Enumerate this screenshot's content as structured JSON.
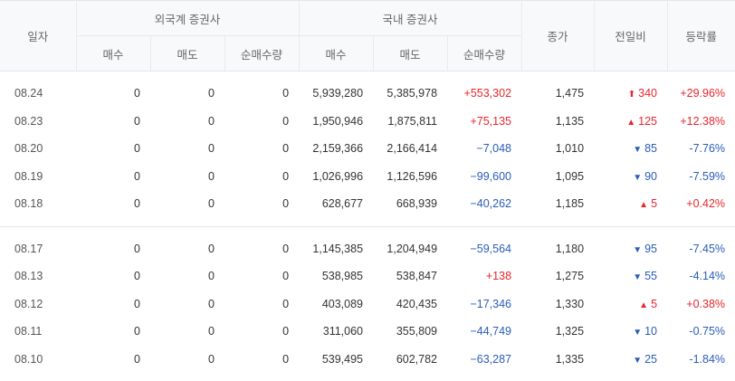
{
  "headers": {
    "date": "일자",
    "foreign": "외국계 증권사",
    "domestic": "국내 증권사",
    "close": "종가",
    "change": "전일비",
    "rate": "등락률",
    "buy": "매수",
    "sell": "매도",
    "net": "순매수량"
  },
  "groups": [
    [
      {
        "date": "08.24",
        "fb": "0",
        "fs": "0",
        "fn": "0",
        "db": "5,939,280",
        "ds": "5,385,978",
        "dn": "+553,302",
        "dn_dir": "up",
        "close": "1,475",
        "arrow": "⬆",
        "chg": "340",
        "chg_dir": "up",
        "rate": "+29.96%"
      },
      {
        "date": "08.23",
        "fb": "0",
        "fs": "0",
        "fn": "0",
        "db": "1,950,946",
        "ds": "1,875,811",
        "dn": "+75,135",
        "dn_dir": "up",
        "close": "1,135",
        "arrow": "▲",
        "chg": "125",
        "chg_dir": "up",
        "rate": "+12.38%"
      },
      {
        "date": "08.20",
        "fb": "0",
        "fs": "0",
        "fn": "0",
        "db": "2,159,366",
        "ds": "2,166,414",
        "dn": "−7,048",
        "dn_dir": "down",
        "close": "1,010",
        "arrow": "▼",
        "chg": "85",
        "chg_dir": "down",
        "rate": "-7.76%"
      },
      {
        "date": "08.19",
        "fb": "0",
        "fs": "0",
        "fn": "0",
        "db": "1,026,996",
        "ds": "1,126,596",
        "dn": "−99,600",
        "dn_dir": "down",
        "close": "1,095",
        "arrow": "▼",
        "chg": "90",
        "chg_dir": "down",
        "rate": "-7.59%"
      },
      {
        "date": "08.18",
        "fb": "0",
        "fs": "0",
        "fn": "0",
        "db": "628,677",
        "ds": "668,939",
        "dn": "−40,262",
        "dn_dir": "down",
        "close": "1,185",
        "arrow": "▲",
        "chg": "5",
        "chg_dir": "up",
        "rate": "+0.42%"
      }
    ],
    [
      {
        "date": "08.17",
        "fb": "0",
        "fs": "0",
        "fn": "0",
        "db": "1,145,385",
        "ds": "1,204,949",
        "dn": "−59,564",
        "dn_dir": "down",
        "close": "1,180",
        "arrow": "▼",
        "chg": "95",
        "chg_dir": "down",
        "rate": "-7.45%"
      },
      {
        "date": "08.13",
        "fb": "0",
        "fs": "0",
        "fn": "0",
        "db": "538,985",
        "ds": "538,847",
        "dn": "+138",
        "dn_dir": "up",
        "close": "1,275",
        "arrow": "▼",
        "chg": "55",
        "chg_dir": "down",
        "rate": "-4.14%"
      },
      {
        "date": "08.12",
        "fb": "0",
        "fs": "0",
        "fn": "0",
        "db": "403,089",
        "ds": "420,435",
        "dn": "−17,346",
        "dn_dir": "down",
        "close": "1,330",
        "arrow": "▲",
        "chg": "5",
        "chg_dir": "up",
        "rate": "+0.38%"
      },
      {
        "date": "08.11",
        "fb": "0",
        "fs": "0",
        "fn": "0",
        "db": "311,060",
        "ds": "355,809",
        "dn": "−44,749",
        "dn_dir": "down",
        "close": "1,325",
        "arrow": "▼",
        "chg": "10",
        "chg_dir": "down",
        "rate": "-0.75%"
      },
      {
        "date": "08.10",
        "fb": "0",
        "fs": "0",
        "fn": "0",
        "db": "539,495",
        "ds": "602,782",
        "dn": "−63,287",
        "dn_dir": "down",
        "close": "1,335",
        "arrow": "▼",
        "chg": "25",
        "chg_dir": "down",
        "rate": "-1.84%"
      }
    ]
  ],
  "colors": {
    "up": "#e8262c",
    "down": "#2a5cb8"
  }
}
